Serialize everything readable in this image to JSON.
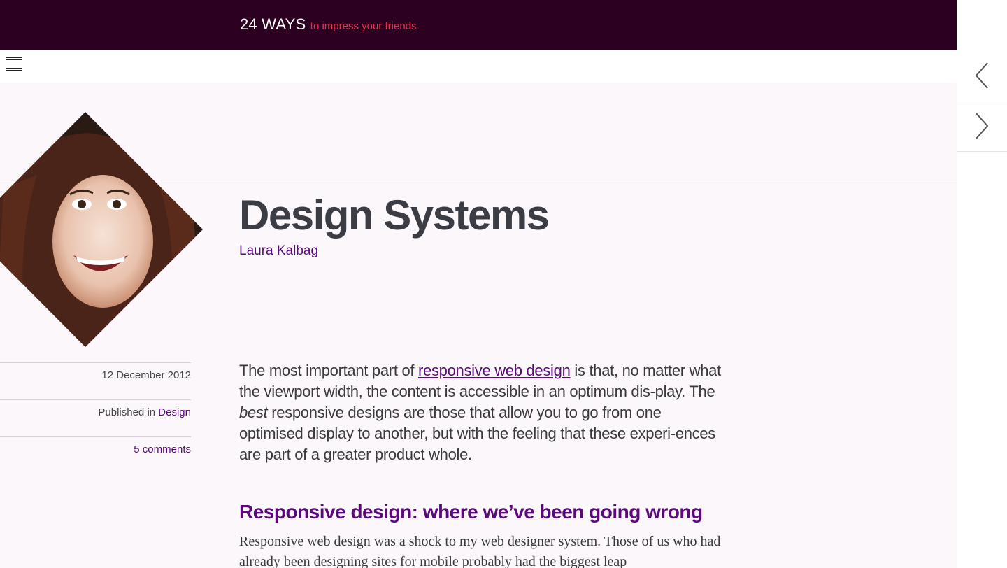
{
  "header": {
    "brand_name": "24 WAYS",
    "brand_tagline": "to impress your friends"
  },
  "colors": {
    "header_bg": "#2b0020",
    "accent": "#5a0a78",
    "tagline": "#e8334f",
    "page_bg": "#fbf7fb"
  },
  "icons": {
    "menu": "hamburger-menu-icon",
    "prev": "chevron-left-icon",
    "next": "chevron-right-icon"
  },
  "article": {
    "title": "Design Systems",
    "author": "Laura Kalbag",
    "date": "12 December 2012",
    "published_prefix": "Published in",
    "category": "Design",
    "comments": "5 comments",
    "intro": {
      "before_link": "The most important part of ",
      "link_text": "responsive web design",
      "after_link": " is that, no matter what the viewport width, the content is accessible in an optimum dis-play. The ",
      "emphasis": "best",
      "rest": " responsive designs are those that allow you to go from one optimised display to another, but with the feeling that these experi-ences are part of a greater product whole."
    },
    "section_heading": "Responsive design: where we’ve been going wrong",
    "body_paragraph": "Responsive web design was a shock to my web designer system. Those of us who had already been designing sites for mobile probably had the biggest leap"
  }
}
